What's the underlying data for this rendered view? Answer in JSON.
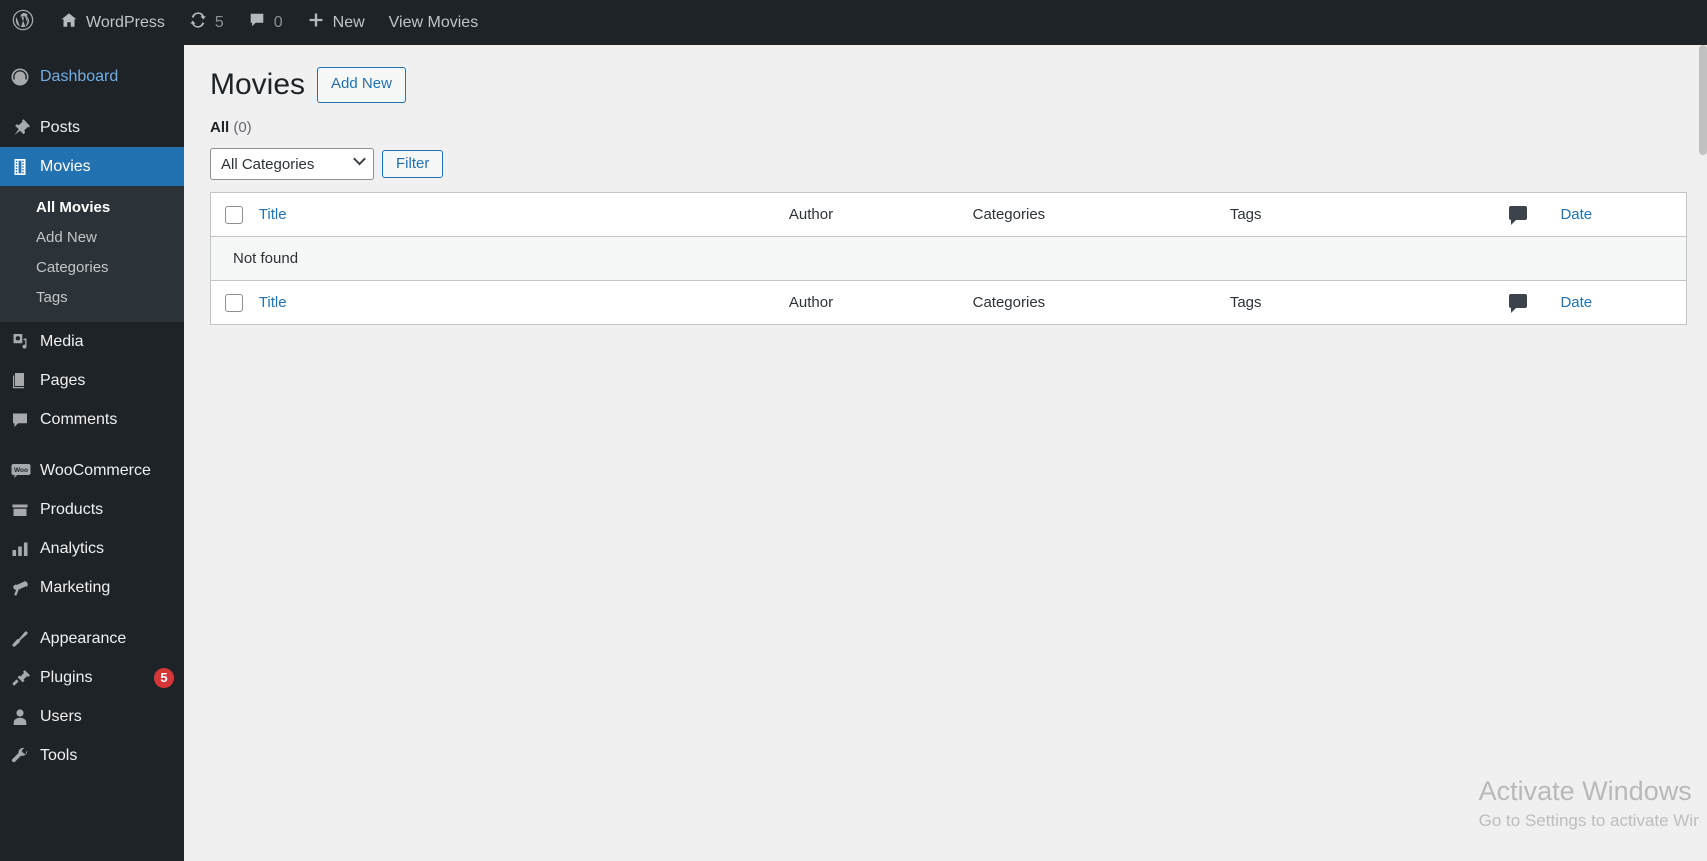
{
  "adminbar": {
    "items": [
      {
        "icon": "wordpress-logo-icon",
        "label": ""
      },
      {
        "icon": "home-icon",
        "label": "WordPress"
      },
      {
        "icon": "updates-icon",
        "label": "5"
      },
      {
        "icon": "comment-bubble-icon",
        "label": "0"
      },
      {
        "icon": "plus-icon",
        "label": "New"
      },
      {
        "icon": "",
        "label": "View Movies"
      }
    ]
  },
  "sidebar": {
    "items": [
      {
        "label": "Dashboard",
        "icon": "dashboard-icon",
        "state": "dashboard"
      },
      {
        "label": "Posts",
        "icon": "pin-icon",
        "state": "normal"
      },
      {
        "label": "Movies",
        "icon": "film-strip-icon",
        "state": "current"
      },
      {
        "label": "Media",
        "icon": "media-icon",
        "state": "normal"
      },
      {
        "label": "Pages",
        "icon": "pages-icon",
        "state": "normal"
      },
      {
        "label": "Comments",
        "icon": "comment-bubble-icon",
        "state": "normal"
      },
      {
        "label": "WooCommerce",
        "icon": "woo-icon",
        "state": "normal"
      },
      {
        "label": "Products",
        "icon": "products-icon",
        "state": "normal"
      },
      {
        "label": "Analytics",
        "icon": "bar-chart-icon",
        "state": "normal"
      },
      {
        "label": "Marketing",
        "icon": "megaphone-icon",
        "state": "normal"
      },
      {
        "label": "Appearance",
        "icon": "paintbrush-icon",
        "state": "normal"
      },
      {
        "label": "Plugins",
        "icon": "plug-icon",
        "state": "normal",
        "badge": "5"
      },
      {
        "label": "Users",
        "icon": "user-icon",
        "state": "normal"
      },
      {
        "label": "Tools",
        "icon": "wrench-icon",
        "state": "normal"
      }
    ],
    "submenu": {
      "parent": "Movies",
      "items": [
        {
          "label": "All Movies",
          "current": true
        },
        {
          "label": "Add New",
          "current": false
        },
        {
          "label": "Categories",
          "current": false
        },
        {
          "label": "Tags",
          "current": false
        }
      ]
    }
  },
  "page": {
    "title": "Movies",
    "add_new_label": "Add New",
    "views": {
      "all_label": "All",
      "all_count": "(0)"
    }
  },
  "filters": {
    "category_select_value": "All Categories",
    "filter_button_label": "Filter"
  },
  "table": {
    "columns": {
      "title": "Title",
      "author": "Author",
      "categories": "Categories",
      "tags": "Tags",
      "comments_icon": "comment-bubble-icon",
      "date": "Date"
    },
    "empty_message": "Not found"
  },
  "watermark": {
    "title": "Activate Windows",
    "subtitle": "Go to Settings to activate Windows."
  },
  "colors": {
    "admin_dark": "#1d2327",
    "submenu_dark": "#2c3338",
    "accent_blue": "#2271b1",
    "link_blue": "#2271b1",
    "badge_red": "#d63638",
    "content_bg": "#f0f0f1"
  }
}
